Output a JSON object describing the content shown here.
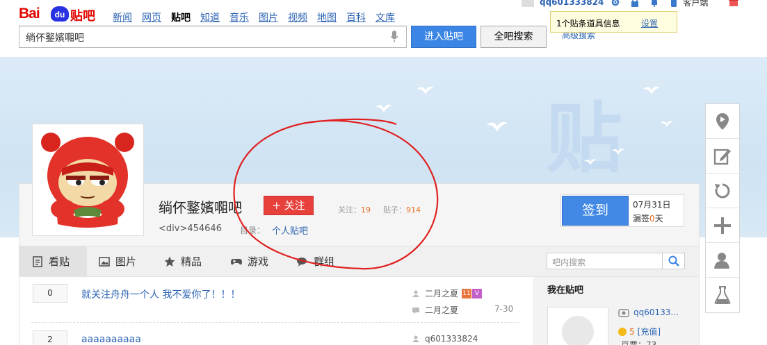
{
  "header": {
    "logo": {
      "bai": "Bai",
      "du": "du",
      "tieba": "贴吧"
    },
    "nav": [
      "新闻",
      "网页",
      "贴吧",
      "知道",
      "音乐",
      "图片",
      "视频",
      "地图",
      "百科",
      "文库"
    ],
    "nav_active": "贴吧",
    "search_value": "绱伓鐜嬪唨吧",
    "enter_button": "进入贴吧",
    "all_search_button": "全吧搜索",
    "advanced_search": "高级搜索"
  },
  "userbar": {
    "username": "qq601333824",
    "client": "客户端",
    "notice": "1个贴条道具信息",
    "settings": "设置"
  },
  "forum": {
    "name": "绱伓鐜嬪唨吧",
    "follow_button": "+ 关注",
    "follow_label": "关注：",
    "follow_count": "19",
    "posts_label": "贴子：",
    "posts_count": "914",
    "id_text": "<div>454646",
    "dir_label": "目录：",
    "dir_link": "个人贴吧"
  },
  "signin": {
    "button": "签到",
    "date": "07月31日",
    "miss_label": "漏签",
    "miss_count": "0",
    "miss_unit": "天"
  },
  "tabs": [
    {
      "label": "看贴",
      "icon": "document-icon",
      "active": true
    },
    {
      "label": "图片",
      "icon": "image-icon",
      "active": false
    },
    {
      "label": "精品",
      "icon": "star-icon",
      "active": false
    },
    {
      "label": "游戏",
      "icon": "gamepad-icon",
      "active": false
    },
    {
      "label": "群组",
      "icon": "chat-icon",
      "active": false
    }
  ],
  "inbox_search_placeholder": "吧内搜索",
  "threads": [
    {
      "replies": "0",
      "title": "就关注舟舟一个人 我不爱你了！！！",
      "author": "二月之夏",
      "last_reply": "二月之夏",
      "time": "7-30"
    },
    {
      "replies": "2",
      "title": "aaaaaaaaaa",
      "author": "q601333824",
      "last_reply": "",
      "time": ""
    }
  ],
  "right_panel": {
    "title": "我在贴吧",
    "username": "qq60133...",
    "coins": "5",
    "recharge": "[充值]",
    "beans": "豆票：73"
  },
  "tools": [
    "location-pin-icon",
    "edit-icon",
    "refresh-icon",
    "plus-icon",
    "user-icon",
    "flask-icon"
  ],
  "colors": {
    "accent": "#3b86e5",
    "brand_red": "#e10602",
    "link": "#2d64b3",
    "follow": "#e8403b",
    "highlight": "#e86f22"
  }
}
